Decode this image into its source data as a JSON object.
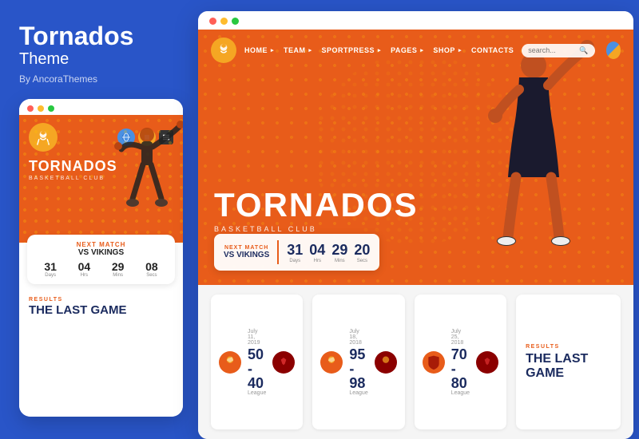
{
  "brand": {
    "name": "Tornados",
    "subtitle": "Theme",
    "by": "By AncoraThemes"
  },
  "nav": {
    "links": [
      "HOME",
      "TEAM",
      "SPORTPRESS",
      "PAGES",
      "SHOP",
      "CONTACTS"
    ],
    "search_placeholder": "search..."
  },
  "hero": {
    "title": "TORNADOS",
    "subtitle": "BASKETBALL CLUB"
  },
  "next_match": {
    "label": "NEXT MATCH",
    "vs": "VS VIKINGS",
    "countdown": {
      "days": {
        "value": "31",
        "label": "Days"
      },
      "hrs": {
        "value": "04",
        "label": "Hrs"
      },
      "mins": {
        "value": "29",
        "label": "Mins"
      },
      "secs": {
        "value": "20",
        "label": "Secs"
      }
    }
  },
  "mobile_next_match": {
    "label": "NEXT MATCH",
    "vs": "VS VIKINGS",
    "countdown": {
      "days": {
        "value": "31",
        "label": "Days"
      },
      "hrs": {
        "value": "04",
        "label": "Hrs"
      },
      "mins": {
        "value": "29",
        "label": "Mins"
      },
      "secs": {
        "value": "08",
        "label": "Secs"
      }
    }
  },
  "results": {
    "label": "RESULTS",
    "title": "THE LAST GAME"
  },
  "scores": [
    {
      "date": "July 11, 2019",
      "score": "50 - 40",
      "league": "League"
    },
    {
      "date": "July 18, 2018",
      "score": "95 - 98",
      "league": "League"
    },
    {
      "date": "July 25, 2018",
      "score": "70 - 80",
      "league": "League"
    }
  ],
  "dots": {
    "topbar": {
      "red": "#ff5f57",
      "yellow": "#febc2e",
      "green": "#28c840"
    }
  },
  "colors": {
    "blue": "#2955c8",
    "orange": "#e85c1a",
    "dark_blue": "#1a2a5e",
    "light_bg": "#f5f5f5"
  }
}
